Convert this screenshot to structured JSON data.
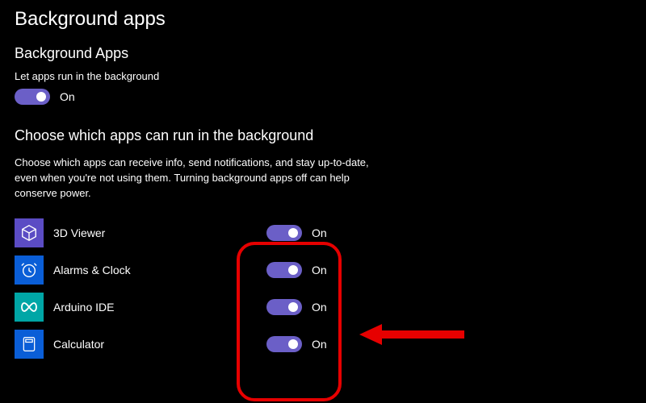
{
  "page_title": "Background apps",
  "master": {
    "heading": "Background Apps",
    "label": "Let apps run in the background",
    "state": "On"
  },
  "choose": {
    "heading": "Choose which apps can run in the background",
    "description": "Choose which apps can receive info, send notifications, and stay up-to-date, even when you're not using them. Turning background apps off can help conserve power."
  },
  "apps": [
    {
      "name": "3D Viewer",
      "state": "On",
      "icon": "cube",
      "color": "purple"
    },
    {
      "name": "Alarms & Clock",
      "state": "On",
      "icon": "alarm",
      "color": "blue"
    },
    {
      "name": "Arduino IDE",
      "state": "On",
      "icon": "infinity",
      "color": "teal"
    },
    {
      "name": "Calculator",
      "state": "On",
      "icon": "calc",
      "color": "blue"
    }
  ],
  "colors": {
    "accent": "#6b5fc7",
    "highlight": "#e60000"
  }
}
